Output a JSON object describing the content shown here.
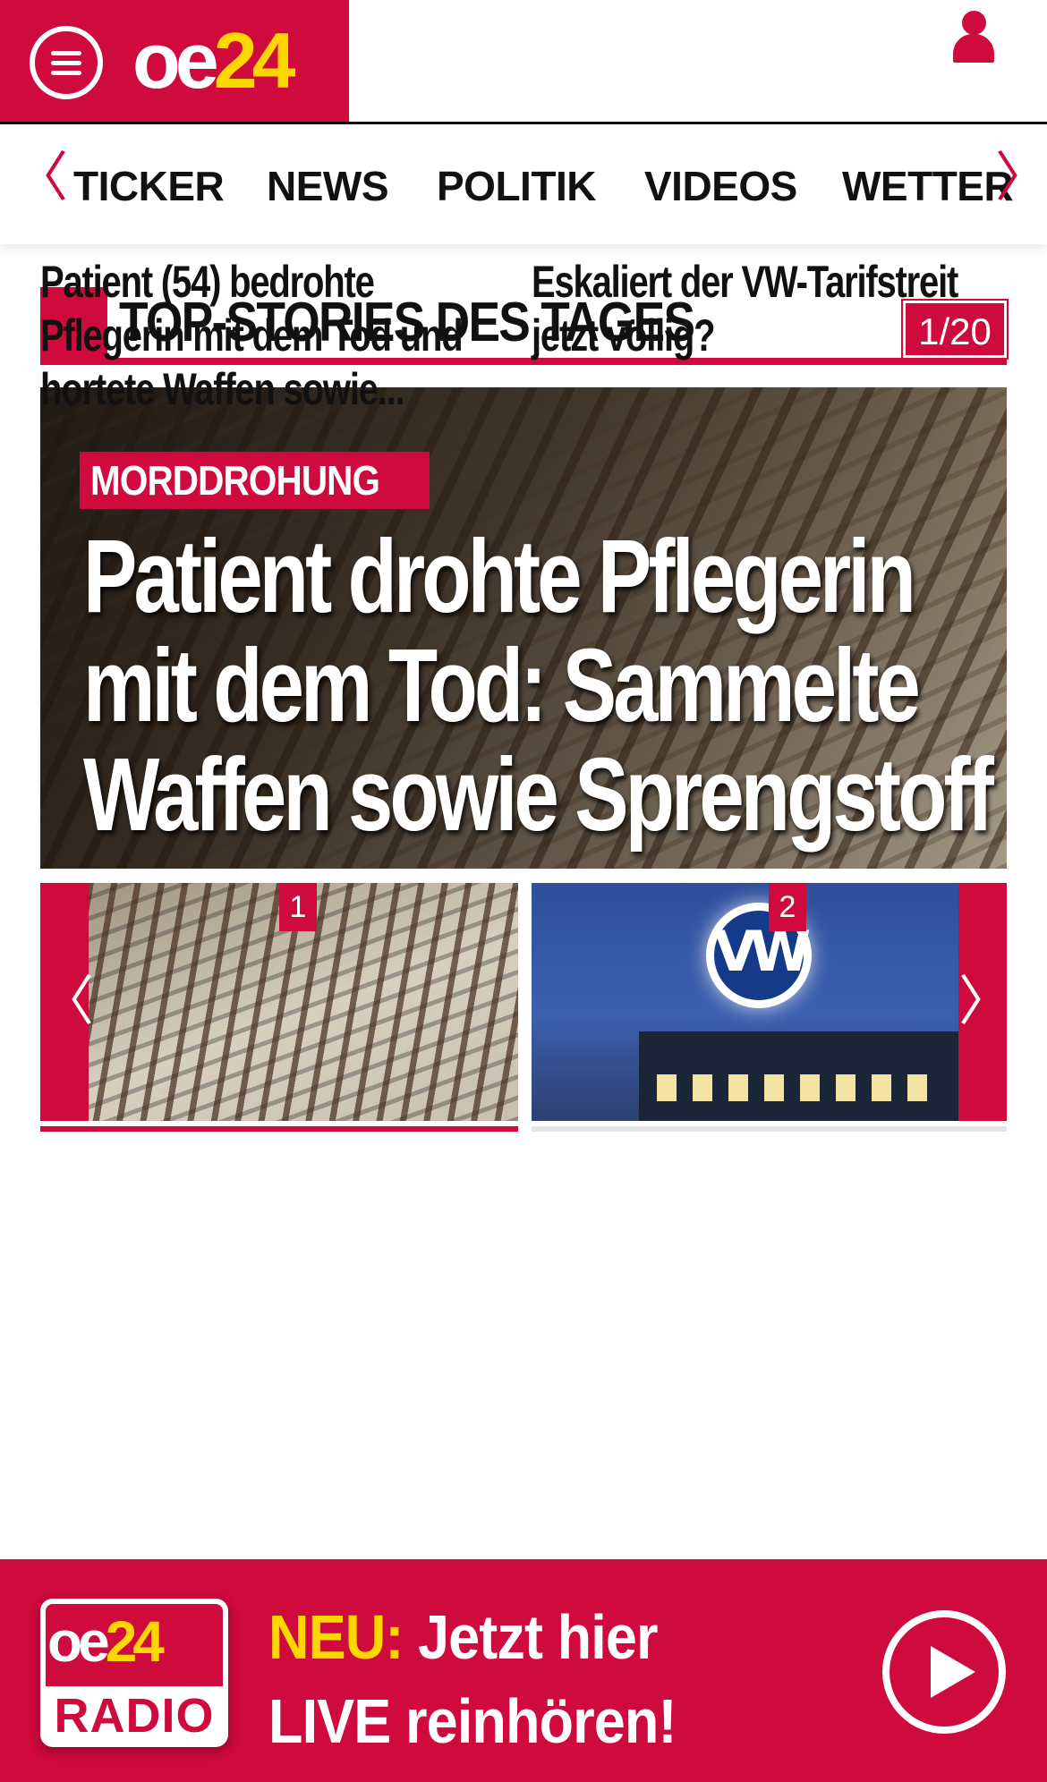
{
  "header": {
    "logo_oe": "oe",
    "logo_24": "24",
    "menu_icon": "hamburger-menu-icon",
    "user_icon": "user-account-icon"
  },
  "nav": {
    "prev_arrow": "〈",
    "next_arrow": "〉",
    "items": [
      "TICKER",
      "NEWS",
      "POLITIK",
      "VIDEOS",
      "WETTER"
    ]
  },
  "section": {
    "title": "TOP-STORIES DES TAGES",
    "counter": "1/20"
  },
  "hero": {
    "kicker": "MORDDROHUNG",
    "headline": "Patient drohte Pflegerin mit dem Tod: Sammelte Waffen sowie Sprengstoff"
  },
  "carousel": {
    "prev_arrow": "〈",
    "next_arrow": "〉",
    "cards": [
      {
        "number": "1",
        "title": "Patient (54) bedrohte Pflegerin mit dem Tod und hortete Waffen sowie..."
      },
      {
        "number": "2",
        "title": "Eskaliert der VW-Tarifstreit jetzt völlig?",
        "logo_text": "VW"
      }
    ]
  },
  "radio": {
    "logo_oe": "oe",
    "logo_24": "24",
    "logo_label": "RADIO",
    "neu": "NEU:",
    "line1": "Jetzt hier",
    "line2": "LIVE reinhören!",
    "play_icon": "play-icon"
  },
  "colors": {
    "brand_red": "#cf0a3c",
    "brand_yellow": "#ffd700"
  }
}
